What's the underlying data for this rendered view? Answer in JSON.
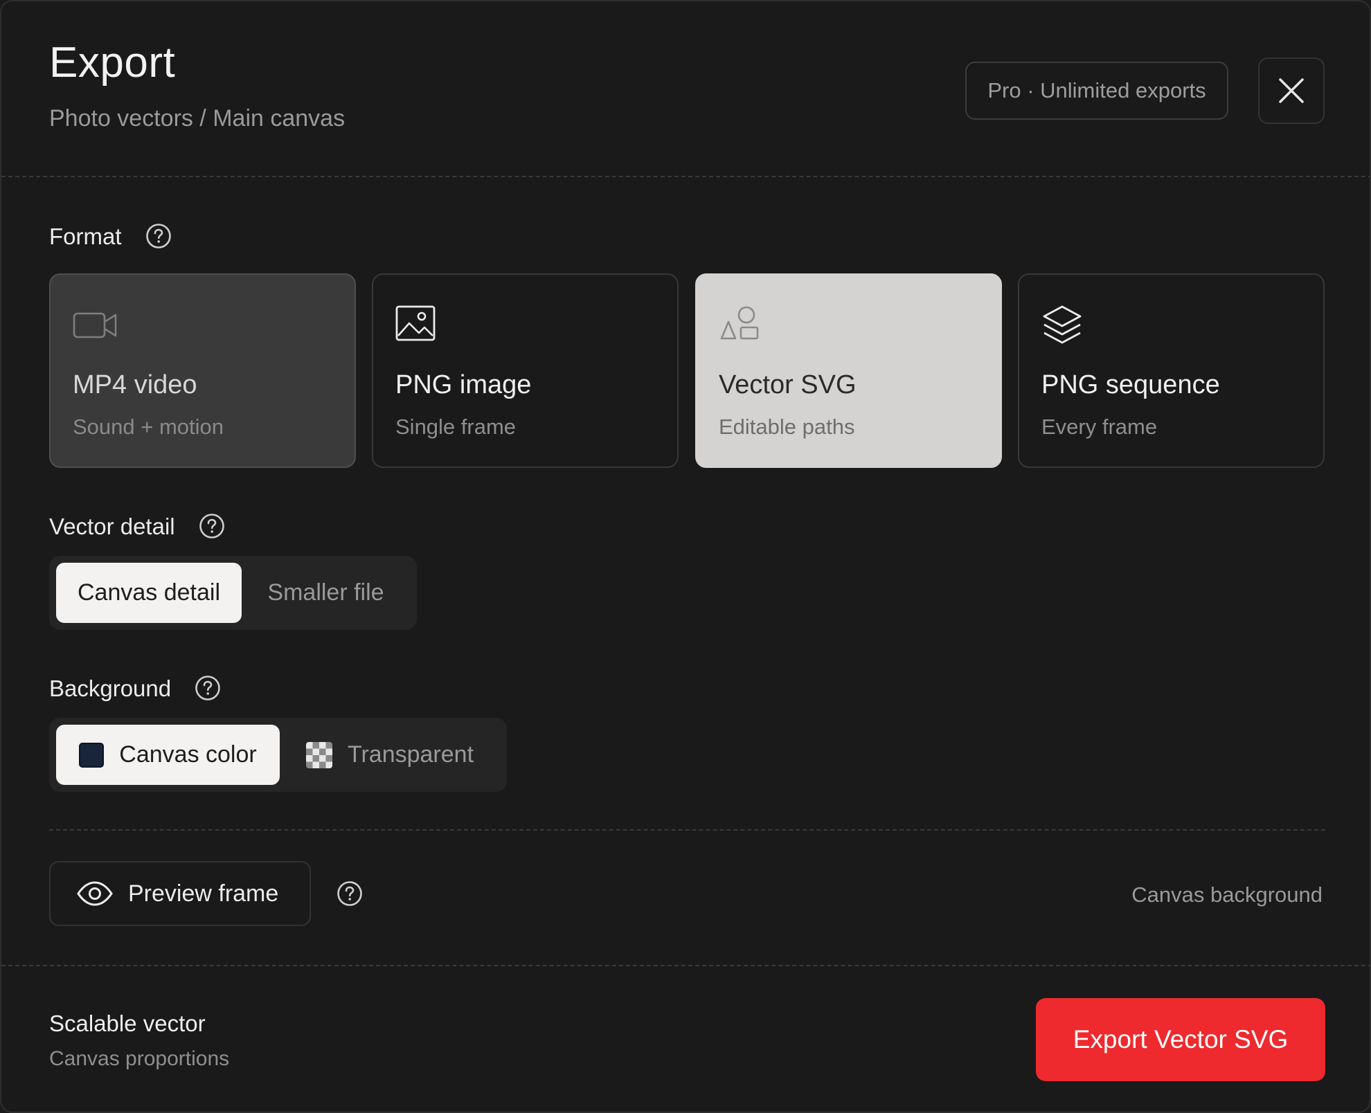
{
  "header": {
    "title": "Export",
    "subtitle": "Photo vectors / Main canvas",
    "plan_badge": "Pro · Unlimited exports"
  },
  "format": {
    "label": "Format",
    "options": [
      {
        "title": "MP4 video",
        "subtitle": "Sound + motion",
        "icon": "video-camera-icon",
        "state": "disabled"
      },
      {
        "title": "PNG image",
        "subtitle": "Single frame",
        "icon": "image-icon",
        "state": "default"
      },
      {
        "title": "Vector SVG",
        "subtitle": "Editable paths",
        "icon": "shapes-icon",
        "state": "selected"
      },
      {
        "title": "PNG sequence",
        "subtitle": "Every frame",
        "icon": "layers-icon",
        "state": "default"
      }
    ]
  },
  "vector_detail": {
    "label": "Vector detail",
    "options": [
      "Canvas detail",
      "Smaller file"
    ],
    "selected": "Canvas detail"
  },
  "background": {
    "label": "Background",
    "options": [
      "Canvas color",
      "Transparent"
    ],
    "selected": "Canvas color",
    "canvas_color": "#18253a"
  },
  "preview": {
    "button_label": "Preview frame",
    "background_note": "Canvas background"
  },
  "footer": {
    "title": "Scalable vector",
    "subtitle": "Canvas proportions",
    "export_label": "Export Vector SVG"
  },
  "colors": {
    "accent": "#ee2a2e",
    "selected_card": "#d4d3d1",
    "surface": "#1a1a1a"
  }
}
